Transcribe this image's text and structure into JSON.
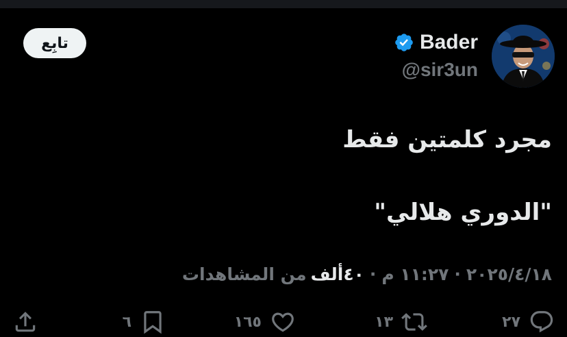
{
  "author": {
    "display_name": "Bader",
    "handle": "@sir3un",
    "verified": true
  },
  "follow_button": {
    "label": "تابِع"
  },
  "tweet": {
    "lines": [
      "مجرد كلمتين فقط",
      "\"الدوري هلالي\""
    ]
  },
  "meta": {
    "time": "١١:٢٧ م",
    "date": "٢٠٢٥/٤/١٨",
    "separator": "·",
    "views_count": "٤٠ألف",
    "views_label": "من المشاهدات"
  },
  "actions": {
    "reply_count": "٢٧",
    "retweet_count": "١٣",
    "like_count": "١٦٥",
    "bookmark_count": "٦"
  },
  "icons": {
    "verified": "verified-badge-icon",
    "reply": "reply-icon",
    "retweet": "retweet-icon",
    "like": "heart-icon",
    "bookmark": "bookmark-icon",
    "share": "share-icon"
  },
  "colors": {
    "background": "#000000",
    "text_primary": "#e7e9ea",
    "text_secondary": "#71767b",
    "verified_blue": "#1d9bf0",
    "follow_bg": "#eff3f4"
  }
}
